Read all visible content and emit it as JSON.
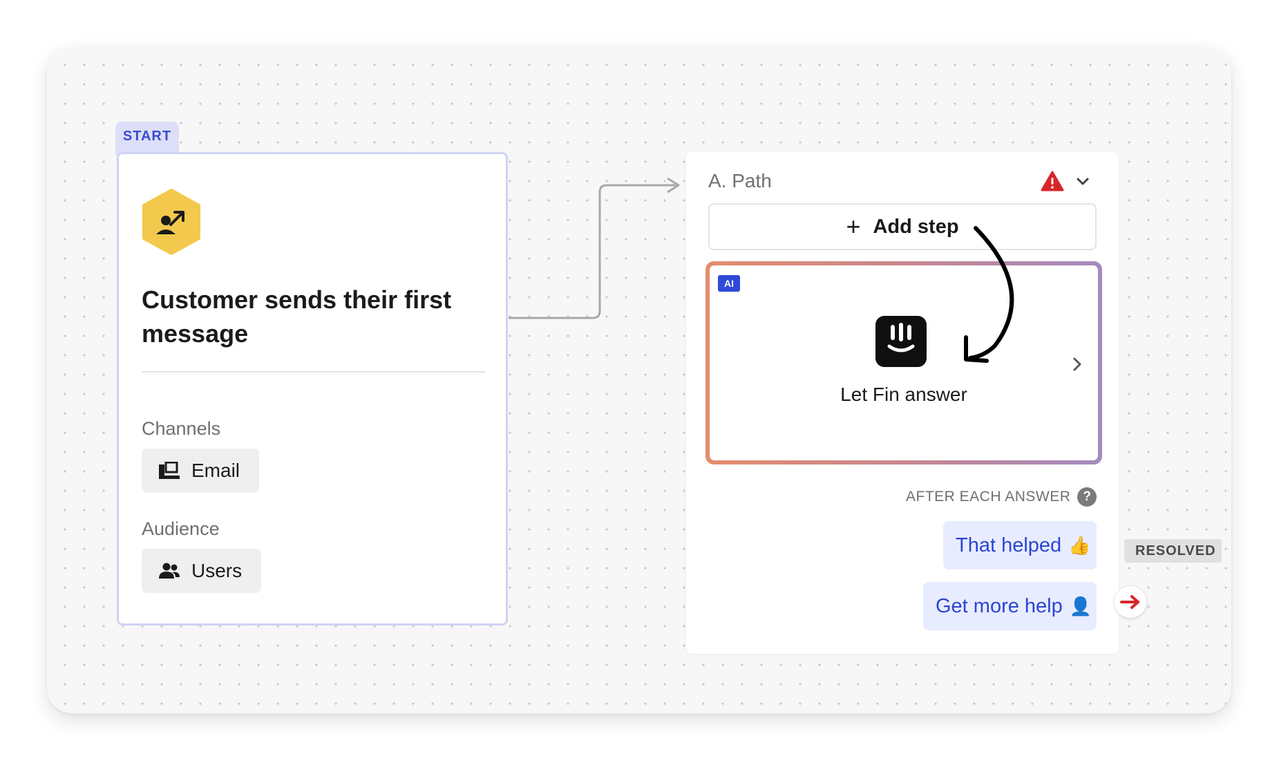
{
  "start_node": {
    "tab_label": "START",
    "title": "Customer sends their first message",
    "channels_label": "Channels",
    "channel_chip": "Email",
    "audience_label": "Audience",
    "audience_chip": "Users",
    "icon_color": "#f2c94c"
  },
  "path_node": {
    "title": "A. Path",
    "add_step_label": "Add step",
    "fin_step": {
      "badge": "AI",
      "label": "Let Fin answer"
    },
    "after_each_answer_label": "AFTER EACH ANSWER",
    "replies": [
      {
        "label": "That helped",
        "emoji": "👍",
        "tag": "RESOLVED"
      },
      {
        "label": "Get more help",
        "emoji": "👤"
      }
    ]
  },
  "colors": {
    "accent_blue": "#2a45d4",
    "warning_red": "#d6262b",
    "fin_gradient_start": "#e48d6d",
    "fin_gradient_end": "#a38ac0"
  }
}
